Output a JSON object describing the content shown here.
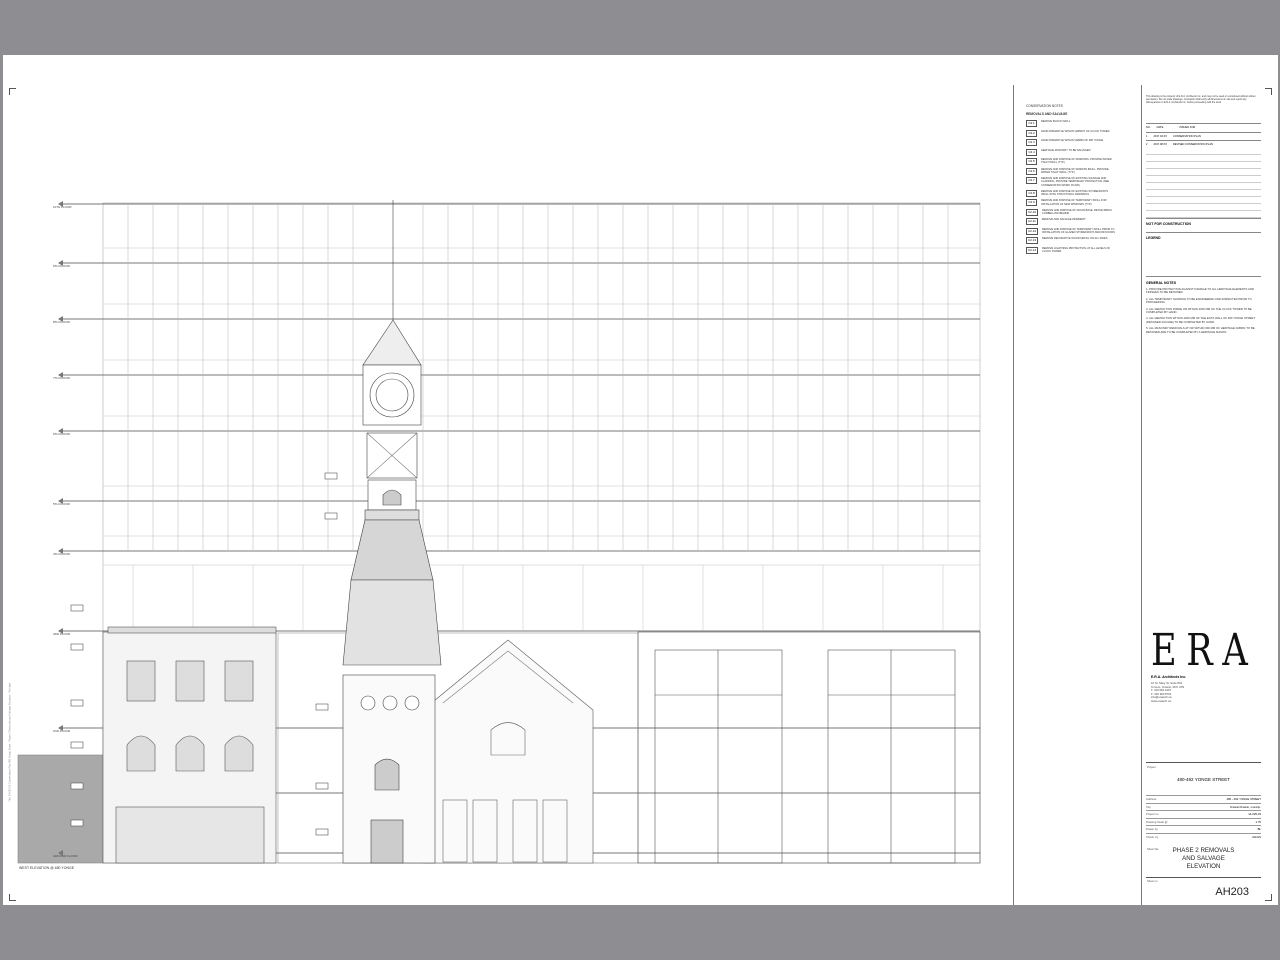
{
  "drawing": {
    "level_tags": [
      "",
      ""
    ],
    "elevation_title": "WEST ELEVATION @ 480 YONGE",
    "floor_labels": [
      "10TH FLOOR",
      "9TH FLOOR",
      "8TH FLOOR",
      "7TH FLOOR",
      "6TH FLOOR",
      "5TH FLOOR",
      "4TH FLOOR",
      "3RD FLOOR",
      "2ND FLOOR",
      "GROUND FLOOR"
    ]
  },
  "notes": {
    "title": "CONSERVATION NOTES",
    "subtitle": "REMOVALS AND SALVAGE",
    "items": [
      {
        "tag": "C2.1",
        "text": "REMOVE BLOCK INFILL"
      },
      {
        "tag": "C2.2",
        "text": "HAND DISMANTLE WITHIN GRIMMY OF CLOCK TOWER"
      },
      {
        "tag": "C2.3",
        "text": "HAND DISMANTLE WITHIN CEMBA OF 480 YONGE"
      },
      {
        "tag": "C2.4",
        "text": "HERITAGE MASONRY TO BE SALVAGED"
      },
      {
        "tag": "C2.5",
        "text": "REMOVE AND DISPOSE OF WINDOWS. PROVIDE WATER TIGHT INFILL (TYP.)"
      },
      {
        "tag": "C2.6",
        "text": "REMOVE AND DISPOSE OF WINDOW INFILL. PROVIDE WATER TIGHT INFILL (TYP.)"
      },
      {
        "tag": "C2.7",
        "text": "REMOVE AND DISPOSE OF EXISTING SIGNAGE AND CLADDING. PROVIDE TEMPORARY PROTECTION (SEE CONSERVATION WORK 00-000)"
      },
      {
        "tag": "C2.8",
        "text": "REMOVE AND DISPOSE OF EXISTING STOREFRONTS INFILL WITH STRUCTURAL DRAWINGS"
      },
      {
        "tag": "C2.9",
        "text": "REMOVE AND DISPOSE OF TEMPORARY INFILL FOR INSTALLATION OF NEW WINDOWS (TYP.)"
      },
      {
        "tag": "C2.10",
        "text": "REMOVE AND DISPOSE OF WOOD BASE. RETAIN BRICK CORBELLING BEHIND"
      },
      {
        "tag": "C2.11",
        "text": "REMOVE AND SALVAGE PEDIMENT"
      },
      {
        "tag": "C2.12",
        "text": "REMOVE AND DISPOSE OF TEMPORARY INFILL PRIOR TO INSTALLATION OF GLAZED STOREFRONT AND/OR DOORS"
      },
      {
        "tag": "C2.13",
        "text": "REMOVE DECORATIVE WOOD DETAIL ON ALL SIDES"
      },
      {
        "tag": "C2.14",
        "text": "REMOVE LIGHTNING PROTECTION, AT ALL LEVELS OF CLOCK TOWER"
      }
    ]
  },
  "titleblock": {
    "disclaimer": "This drawing is the property of E.R.A. Architects Inc. and may not be used or reproduced without written permission. Do not scale drawings. Contractor shall verify all dimensions on site and report any discrepancies to E.R.A. Architects Inc. before proceeding with the work.",
    "rev_headers": [
      "NO.",
      "DATE",
      "ISSUED FOR"
    ],
    "revisions": [
      {
        "no": "1",
        "date": "2017.04.XX",
        "desc": "CONSERVATION PLAN"
      },
      {
        "no": "2",
        "date": "2017.08.XX",
        "desc": "REVISED CONSERVATION PLAN"
      }
    ],
    "not_for_construction": "NOT FOR CONSTRUCTION",
    "legend": "LEGEND",
    "general_notes_title": "GENERAL NOTES",
    "general_notes": [
      "1.  PROVIDE PROTECTION AGAINST DAMAGE TO ALL HERITAGE ELEMENTS AND FINISHES TO BE RETAINED.",
      "2.  ALL TEMPORARY SHORING TO BE ENGINEERED AND INSPECTED PRIOR TO PROCEEDING.",
      "3.  ALL DEMOLITION INSIDE OR WITHIN 2000 MM OF THE CLOCK TOWER TO BE COMPLETED BY HAND.",
      "4.  ALL DEMOLITION WITHIN 1000 MM OF THE EAST WALL OF 480 YONGE STREET (RETAINED FACADE) TO BE COMPLETED BY HAND.",
      "5.  ALL MASONRY REMOVALS AT OR WITHIN 300 MM OF HERITAGE FABRIC TO BE RETAINED ARE TO BE COMPLETED BY A HERITAGE MASON."
    ],
    "logo": "ERA",
    "firm": "E.R.A. Architects Inc.",
    "address": [
      "10 St. Mary St, Suite 801",
      "Toronto, Ontario, M4Y 1P9",
      "T: 416 963 4497",
      "F: 416 963 8761",
      "info@eraarch.ca",
      "www.eraarch.ca"
    ],
    "project_label": "Project",
    "project": "480-492 YONGE STREET",
    "fields": [
      {
        "label": "Address",
        "value": "480 - 492 YONGE STREET"
      },
      {
        "label": "City",
        "value": "Ontario/Ontario, municip."
      },
      {
        "label": "Project no.",
        "value": "14-025-03"
      },
      {
        "label": "Drawing Scale @",
        "value": "1:75"
      },
      {
        "label": "Drawn by",
        "value": "BL"
      },
      {
        "label": "Check. by",
        "value": "AN/GS"
      }
    ],
    "sheet_title_label": "Sheet title",
    "sheet_title": [
      "PHASE 2 REMOVALS",
      "AND SALVAGE",
      "ELEVATION"
    ],
    "sheet_no_label": "Sheet no.",
    "sheet_no": "AH203"
  },
  "side_stamp": "File: 14-025-03 Conservation Plan 480 Yonge Street - Phase 2 Removals and Salvage Elevation - Plot date"
}
